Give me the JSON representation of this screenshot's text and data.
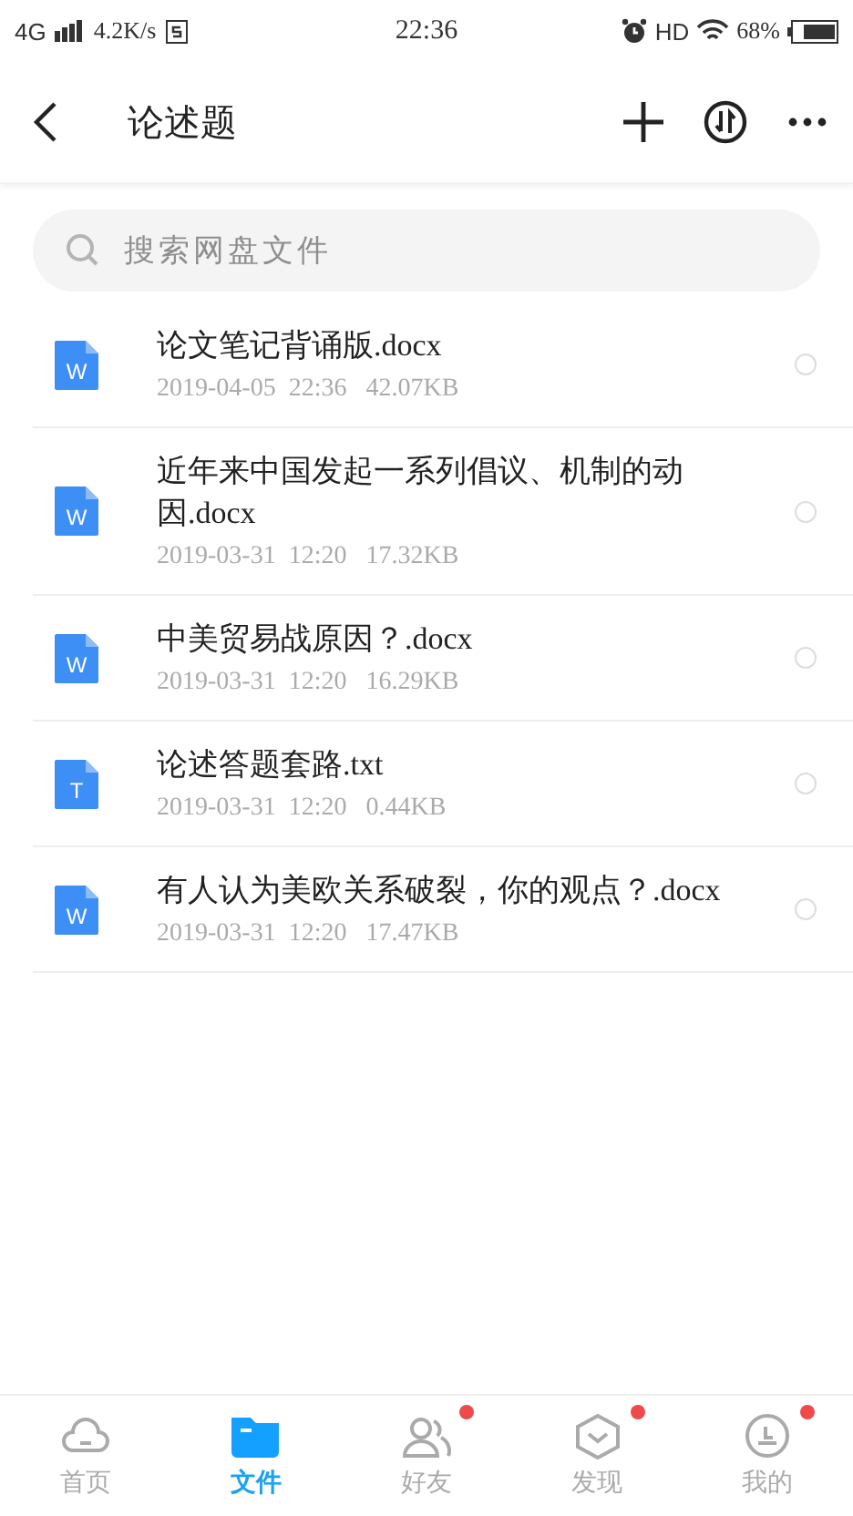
{
  "status_bar": {
    "network": "4G",
    "speed": "4.2K/s",
    "time": "22:36",
    "hd": "HD",
    "battery": "68%"
  },
  "header": {
    "title": "论述题"
  },
  "search": {
    "placeholder": "搜索网盘文件"
  },
  "files": [
    {
      "icon_letter": "W",
      "name": "论文笔记背诵版.docx",
      "meta": "2019-04-05  22:36   42.07KB",
      "selected": false
    },
    {
      "icon_letter": "W",
      "name": "近年来中国发起一系列倡议、机制的动因.docx",
      "meta": "2019-03-31  12:20   17.32KB",
      "selected": false
    },
    {
      "icon_letter": "W",
      "name": "中美贸易战原因？.docx",
      "meta": "2019-03-31  12:20   16.29KB",
      "selected": false
    },
    {
      "icon_letter": "T",
      "name": "论述答题套路.txt",
      "meta": "2019-03-31  12:20   0.44KB",
      "selected": false
    },
    {
      "icon_letter": "W",
      "name": "有人认为美欧关系破裂，你的观点？.docx",
      "meta": "2019-03-31  12:20   17.47KB",
      "selected": false
    }
  ],
  "tabs": [
    {
      "kind": "home",
      "label": "首页",
      "selected": false,
      "badge": false
    },
    {
      "kind": "files",
      "label": "文件",
      "selected": true,
      "badge": false
    },
    {
      "kind": "friends",
      "label": "好友",
      "selected": false,
      "badge": true
    },
    {
      "kind": "discover",
      "label": "发现",
      "selected": false,
      "badge": true
    },
    {
      "kind": "me",
      "label": "我的",
      "selected": false,
      "badge": true
    }
  ]
}
